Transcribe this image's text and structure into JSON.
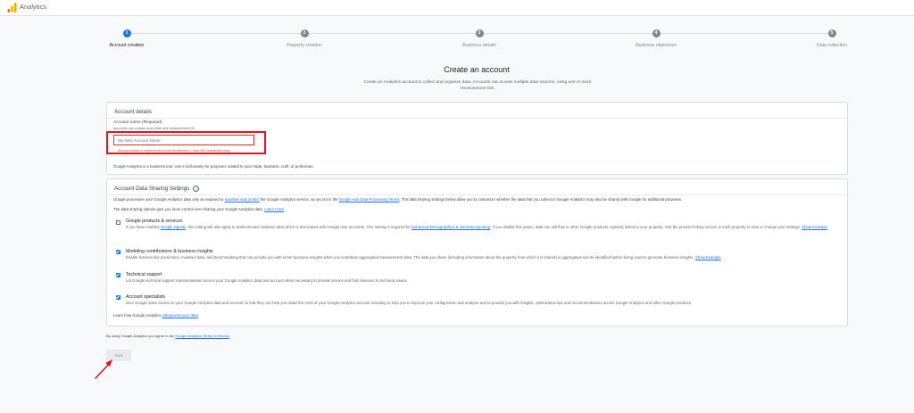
{
  "app": {
    "title": "Analytics"
  },
  "stepper": {
    "steps": [
      {
        "number": "1",
        "label": "Account creation"
      },
      {
        "number": "2",
        "label": "Property creation"
      },
      {
        "number": "3",
        "label": "Business details"
      },
      {
        "number": "4",
        "label": "Business objectives"
      },
      {
        "number": "5",
        "label": "Data collection"
      }
    ]
  },
  "page": {
    "title": "Create an account",
    "subtitle": "Create an Analytics account to collect and organize data. Accounts can access multiple data sources, using one or more measurement IDs."
  },
  "account_details": {
    "title": "Account details",
    "name_label": "Account name (Required)",
    "name_hint": "Accounts can contain more than one measurement ID.",
    "name_placeholder": "My New Account Name",
    "name_error": "Account name is required and must be between 2 and 100 characters long.",
    "business_note": "Google Analytics is a business tool. Use it exclusively for purposes related to your trade, business, craft, or profession."
  },
  "sharing": {
    "title": "Account Data Sharing Settings",
    "intro_prefix": "Google processes your Google Analytics data only as required to",
    "intro_link1": "maintain and protect",
    "intro_mid": "the Google Analytics service, as set out in the",
    "intro_link2": "Google Ads Data Processing Terms",
    "intro_suffix": ". The data sharing settings below allow you to customize whether the data that you collect in Google Analytics may also be shared with Google for additional purposes.",
    "control_text": "The data sharing options give you more control over sharing your Google Analytics data.",
    "learn_more": "Learn more",
    "options": [
      {
        "title": "Google products & services",
        "desc_a": "If you have enabled",
        "link_a": "Google signals",
        "desc_b": ", this setting will also apply to authenticated visitation data which is associated with Google user accounts. This setting is required for",
        "link_b": "Enhanced Demographics & Interests reporting",
        "desc_c": ". If you disable this option, data can still flow to other Google products explicitly linked to your property. Visit the product linking section in each",
        "desc_line2": "property to view or change your settings.",
        "show_example": "Show Example"
      },
      {
        "title": "Modeling contributions & business insights",
        "desc": "Enable features like predictions, modeled data, and benchmarking that can provide you with richer business insights when you contribute aggregated measurement data. The data you share (including information about the property from which it is shared) is aggregated and de-identified before being used to generate business insights.",
        "show_example": "Show Example"
      },
      {
        "title": "Technical support",
        "desc": "Let Google technical support representatives access your Google Analytics data and account when necessary to provide service and find solutions to technical issues."
      },
      {
        "title": "Account specialists",
        "desc": "Give Google sales access to your Google Analytics data and account so that they can help you make the most of your Google Analytics account including to help you to improve your configuration and analysis and to provide you with insights, optimization tips and recommendations across Google Analytics and other Google products."
      }
    ],
    "safeguards_prefix": "Learn how Google Analytics",
    "safeguards_link": "safeguards your data"
  },
  "footer": {
    "tos_prefix": "By using Google Analytics you agree to the",
    "tos_link": "Google Analytics Terms of Service",
    "next_label": "Next"
  },
  "colors": {
    "accent": "#1a73e8",
    "error": "#d93025",
    "highlight": "#e8141c",
    "logo_orange": "#f9ab00",
    "logo_dark": "#e37400"
  }
}
